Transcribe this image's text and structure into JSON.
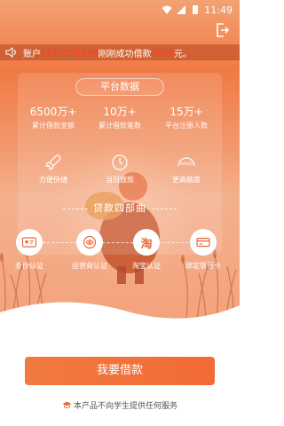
{
  "status_bar": {
    "time": "11:49"
  },
  "notice": {
    "prefix": "账户",
    "account": "155****1234",
    "middle": "刚刚成功借款",
    "amount": "5000",
    "suffix": "元。"
  },
  "platform": {
    "title": "平台数据",
    "stats": [
      {
        "value": "6500万+",
        "label": "累计借款金额"
      },
      {
        "value": "10万+",
        "label": "累计借款笔数"
      },
      {
        "value": "15万+",
        "label": "平台注册人数"
      }
    ],
    "features": [
      {
        "label": "方便快捷",
        "icon": "rocket-icon"
      },
      {
        "label": "当日放款",
        "icon": "clock-icon"
      },
      {
        "label": "更高额度",
        "icon": "gauge-icon",
        "gauge_text": "80000"
      }
    ]
  },
  "process": {
    "title": "贷款四部曲",
    "steps": [
      {
        "label": "身份认证",
        "icon": "id-card-icon"
      },
      {
        "label": "运营商认证",
        "icon": "phone-carrier-icon"
      },
      {
        "label": "淘宝认证",
        "icon": "taobao-icon",
        "glyph": "淘"
      },
      {
        "label": "绑定银行卡",
        "icon": "bank-card-icon"
      }
    ]
  },
  "cta": {
    "label": "我要借款"
  },
  "footnote": {
    "text": "本产品不向学生提供任何服务"
  },
  "colors": {
    "accent": "#f07a3f",
    "highlight": "#ff3b2a"
  }
}
